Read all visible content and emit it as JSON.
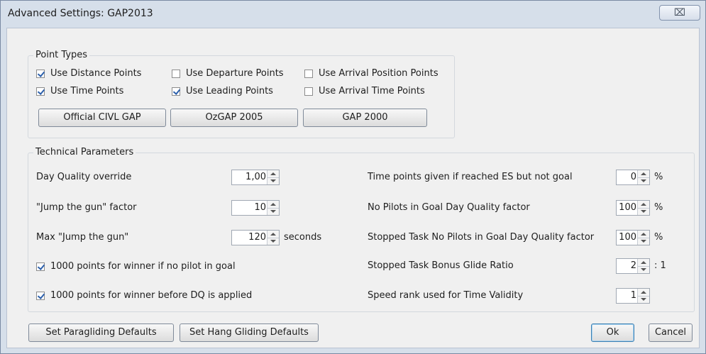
{
  "window": {
    "title": "Advanced Settings: GAP2013",
    "close_glyph": "⌧"
  },
  "point_types": {
    "legend": "Point Types",
    "checkboxes": [
      {
        "label": "Use Distance Points",
        "checked": true
      },
      {
        "label": "Use Departure Points",
        "checked": false
      },
      {
        "label": "Use Arrival Position Points",
        "checked": false
      },
      {
        "label": "Use Time Points",
        "checked": true
      },
      {
        "label": "Use Leading Points",
        "checked": true
      },
      {
        "label": "Use Arrival Time Points",
        "checked": false
      }
    ],
    "buttons": [
      "Official CIVL GAP",
      "OzGAP 2005",
      "GAP 2000"
    ]
  },
  "technical": {
    "legend": "Technical Parameters",
    "left": [
      {
        "label": "Day Quality override",
        "value": "1,00",
        "unit": ""
      },
      {
        "label": "\"Jump the gun\" factor",
        "value": "10",
        "unit": ""
      },
      {
        "label": "Max \"Jump the gun\"",
        "value": "120",
        "unit": "seconds"
      }
    ],
    "left_checks": [
      {
        "label": "1000 points for winner if no pilot in goal",
        "checked": true
      },
      {
        "label": "1000 points for winner before DQ is applied",
        "checked": true
      }
    ],
    "right": [
      {
        "label": "Time points given if reached ES but not goal",
        "value": "0",
        "unit": "%"
      },
      {
        "label": "No Pilots in Goal Day Quality factor",
        "value": "100",
        "unit": "%"
      },
      {
        "label": "Stopped Task No Pilots in Goal Day Quality factor",
        "value": "100",
        "unit": "%"
      },
      {
        "label": "Stopped Task Bonus Glide Ratio",
        "value": "2",
        "unit": ": 1"
      },
      {
        "label": "Speed rank used for Time Validity",
        "value": "1",
        "unit": ""
      }
    ]
  },
  "footer": {
    "paragliding_defaults": "Set Paragliding Defaults",
    "hang_gliding_defaults": "Set Hang Gliding Defaults",
    "ok": "Ok",
    "cancel": "Cancel"
  }
}
